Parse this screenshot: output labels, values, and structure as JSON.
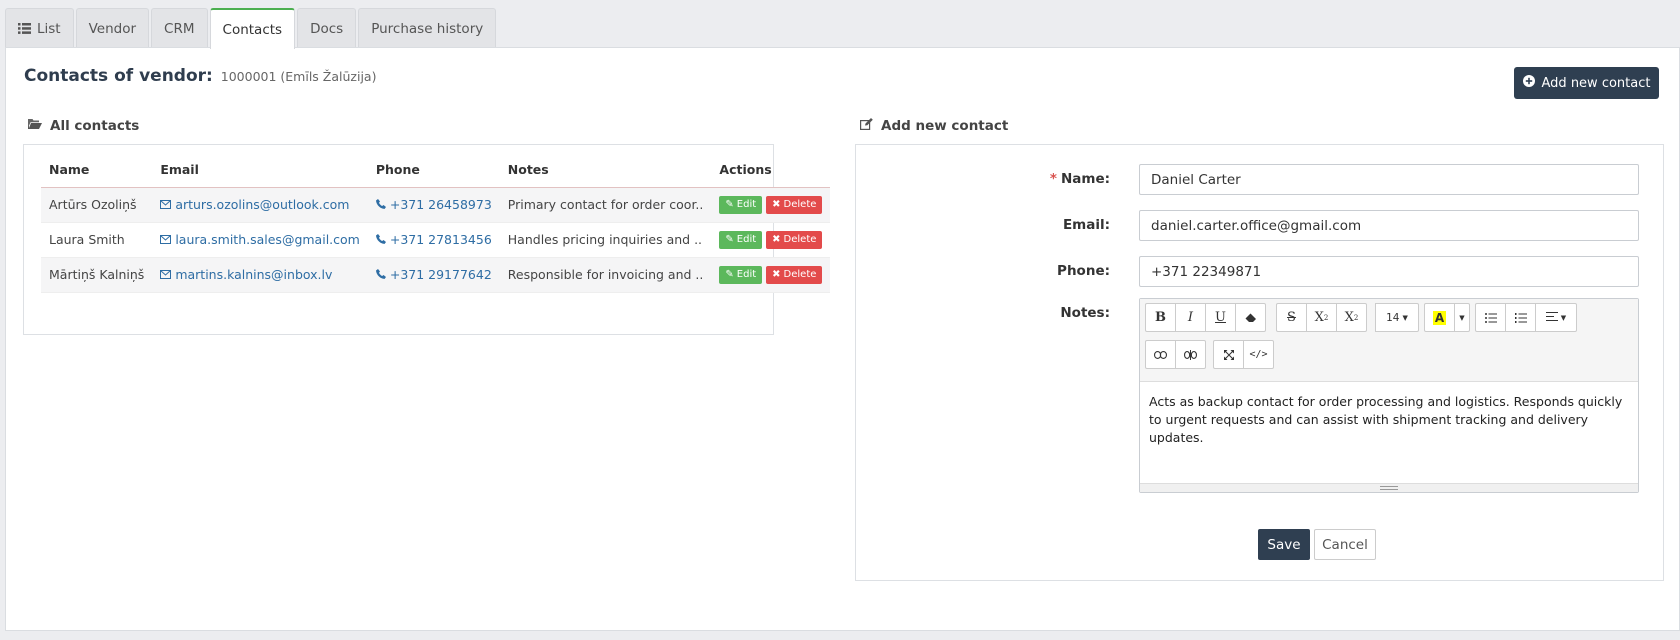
{
  "tabs": [
    {
      "label": "List",
      "icon": "list-icon"
    },
    {
      "label": "Vendor"
    },
    {
      "label": "CRM"
    },
    {
      "label": "Contacts",
      "active": true
    },
    {
      "label": "Docs"
    },
    {
      "label": "Purchase history"
    }
  ],
  "header": {
    "title": "Contacts of vendor:",
    "subtitle": "1000001 (Emīls Žalūzija)",
    "add_button": "Add new contact"
  },
  "contacts_section": {
    "label": "All contacts",
    "columns": [
      "Name",
      "Email",
      "Phone",
      "Notes",
      "Actions"
    ],
    "rows": [
      {
        "name": "Artūrs Ozoliņš",
        "email": "arturs.ozolins@outlook.com",
        "phone": "+371 26458973",
        "notes": "Primary contact for order coor.."
      },
      {
        "name": "Laura Smith",
        "email": "laura.smith.sales@gmail.com",
        "phone": "+371 27813456",
        "notes": "Handles pricing inquiries and .."
      },
      {
        "name": "Mārtiņš Kalniņš",
        "email": "martins.kalnins@inbox.lv",
        "phone": "+371 29177642",
        "notes": "Responsible for invoicing and .."
      }
    ],
    "edit_label": "Edit",
    "delete_label": "Delete"
  },
  "form": {
    "section_label": "Add new contact",
    "name_label": "Name:",
    "name_value": "Daniel Carter",
    "email_label": "Email:",
    "email_value": "daniel.carter.office@gmail.com",
    "phone_label": "Phone:",
    "phone_value": "+371 22349871",
    "notes_label": "Notes:",
    "notes_value": "Acts as backup contact for order processing and logistics. Responds quickly to urgent requests and can assist with shipment tracking and delivery updates.",
    "font_size": "14",
    "save_label": "Save",
    "cancel_label": "Cancel"
  },
  "colors": {
    "primary": "#2f3f51",
    "success": "#5cb85c",
    "danger": "#e34b4b",
    "link": "#2e6da4",
    "active_tab_accent": "#4caf50"
  }
}
